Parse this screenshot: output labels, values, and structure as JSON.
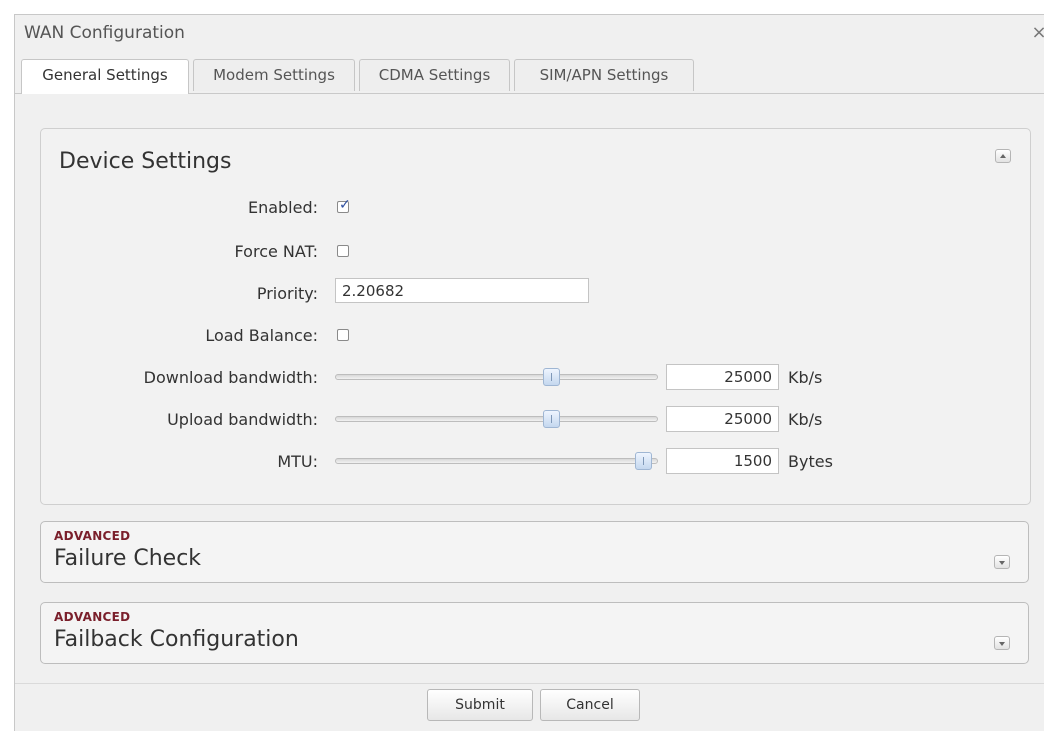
{
  "dialog": {
    "title": "WAN Configuration",
    "close_glyph": "×"
  },
  "tabs": [
    {
      "label": "General Settings",
      "active": true
    },
    {
      "label": "Modem Settings",
      "active": false
    },
    {
      "label": "CDMA Settings",
      "active": false
    },
    {
      "label": "SIM/APN Settings",
      "active": false
    }
  ],
  "device_settings": {
    "title": "Device Settings",
    "collapse_icon": "collapse-up-icon",
    "enabled": {
      "label": "Enabled:",
      "checked": true
    },
    "force_nat": {
      "label": "Force NAT:",
      "checked": false
    },
    "priority": {
      "label": "Priority:",
      "value": "2.20682"
    },
    "load_balance": {
      "label": "Load Balance:",
      "checked": false
    },
    "download_bandwidth": {
      "label": "Download bandwidth:",
      "value": "25000",
      "unit": "Kb/s",
      "slider_level": 0.68
    },
    "upload_bandwidth": {
      "label": "Upload bandwidth:",
      "value": "25000",
      "unit": "Kb/s",
      "slider_level": 0.68
    },
    "mtu": {
      "label": "MTU:",
      "value": "1500",
      "unit": "Bytes",
      "slider_level": 0.98
    }
  },
  "failure_check": {
    "tag": "ADVANCED",
    "title": "Failure Check",
    "expand_icon": "expand-down-icon"
  },
  "failback_configuration": {
    "tag": "ADVANCED",
    "title": "Failback Configuration",
    "expand_icon": "expand-down-icon"
  },
  "buttons": {
    "submit": "Submit",
    "cancel": "Cancel"
  },
  "colors": {
    "advanced_tag": "#7a1f2b",
    "checkmark": "#2e4fa0"
  }
}
